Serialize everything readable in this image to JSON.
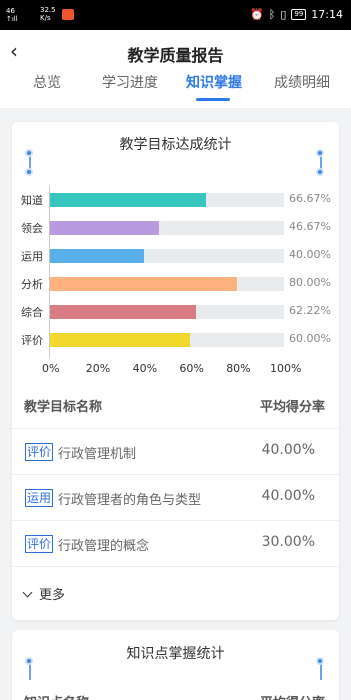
{
  "status_bar": {
    "signal": "46\n↑ıll",
    "net_speed": "32.5\nK/s",
    "battery": "99",
    "time": "17:14"
  },
  "header": {
    "back_icon": "chevron-left-icon",
    "title": "教学质量报告",
    "tabs": [
      "总览",
      "学习进度",
      "知识掌握",
      "成绩明细"
    ],
    "active_tab": "知识掌握",
    "accent": "#2e7ae6"
  },
  "card1": {
    "title": "教学目标达成统计"
  },
  "chart_data": {
    "type": "bar",
    "orientation": "horizontal",
    "categories": [
      "知道",
      "领会",
      "运用",
      "分析",
      "综合",
      "评价"
    ],
    "values": [
      66.67,
      46.67,
      40.0,
      80.0,
      62.22,
      60.0
    ],
    "value_labels": [
      "66.67%",
      "46.67%",
      "40.00%",
      "80.00%",
      "62.22%",
      "60.00%"
    ],
    "colors": [
      "#36c6bd",
      "#b79ae0",
      "#5aaeea",
      "#ffb27d",
      "#d97b85",
      "#f2d82c"
    ],
    "xticks": [
      "0%",
      "20%",
      "40%",
      "60%",
      "80%",
      "100%"
    ],
    "xlim": [
      0,
      100
    ],
    "title": "",
    "xlabel": "",
    "ylabel": ""
  },
  "table": {
    "header_name": "教学目标名称",
    "header_value": "平均得分率",
    "rows": [
      {
        "tag": "评价",
        "name": "行政管理机制",
        "value": "40.00%"
      },
      {
        "tag": "运用",
        "name": "行政管理者的角色与类型",
        "value": "40.00%"
      },
      {
        "tag": "评价",
        "name": "行政管理的概念",
        "value": "30.00%"
      }
    ],
    "more_label": "更多"
  },
  "card2": {
    "title": "知识点掌握统计",
    "header_name": "知识点名称",
    "header_value": "平均得分率"
  }
}
